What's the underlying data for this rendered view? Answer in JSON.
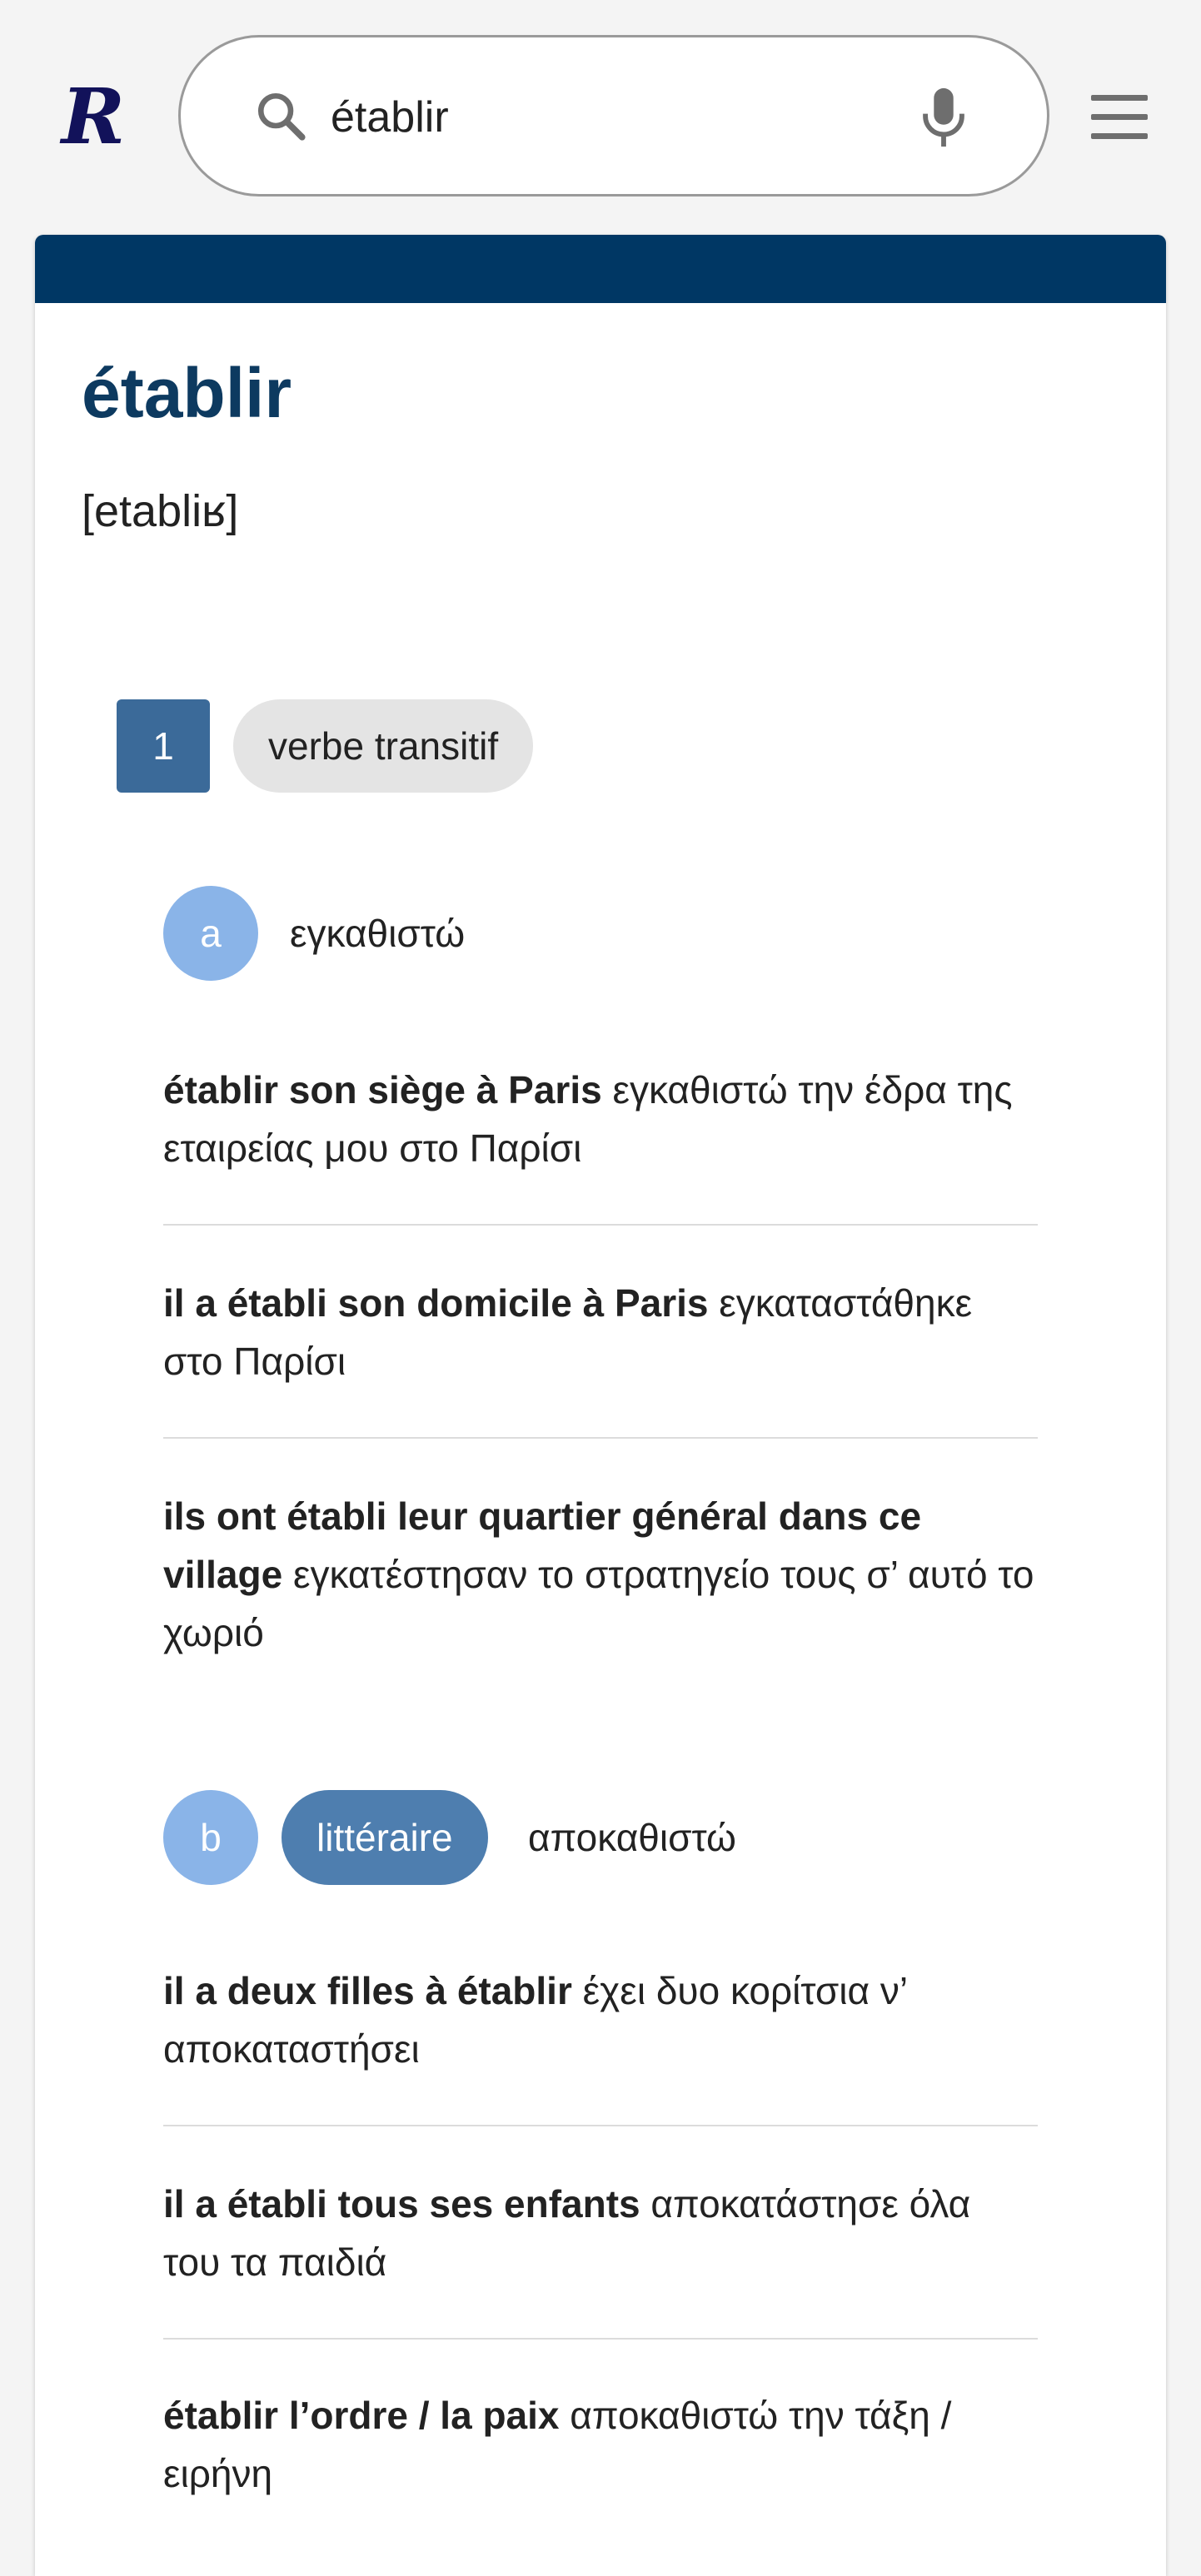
{
  "header": {
    "logo": "R",
    "search_value": "établir",
    "search_placeholder": "",
    "search_icon": "search-icon",
    "mic_icon": "mic-icon",
    "menu_icon": "hamburger-menu-icon"
  },
  "entry": {
    "headword": "établir",
    "phonetic": "[etabliʁ]",
    "senses": [
      {
        "number": "1",
        "pos": "verbe transitif",
        "subsenses": [
          {
            "letter": "a",
            "register": "",
            "translation": "εγκαθιστώ",
            "examples": [
              {
                "source": "établir son siège à Paris",
                "target": "εγκαθιστώ την έδρα της εταιρείας μου στο Παρίσι"
              },
              {
                "source": "il a établi son domicile à Paris",
                "target": "εγκαταστάθηκε στο Παρίσι"
              },
              {
                "source": "ils ont établi leur quartier général dans ce village",
                "target": "εγκατέστησαν το στρατηγείο τους σ’ αυτό το χωριό"
              }
            ]
          },
          {
            "letter": "b",
            "register": "littéraire",
            "translation": "αποκαθιστώ",
            "examples": [
              {
                "source": "il a deux filles à établir",
                "target": "έχει δυο κορίτσια ν’ αποκαταστήσει"
              },
              {
                "source": "il a établi tous ses enfants",
                "target": "αποκατάστησε όλα του τα παιδιά"
              },
              {
                "source": "établir l’ordre / la paix",
                "target": "αποκαθιστώ την τάξη / ειρήνη"
              }
            ]
          }
        ]
      }
    ]
  },
  "colors": {
    "band": "#003764",
    "headword": "#0d3a60",
    "sense_number": "#3b6a99",
    "subsense_circle": "#8ab4e8",
    "register_pill": "#4e7eaf"
  }
}
